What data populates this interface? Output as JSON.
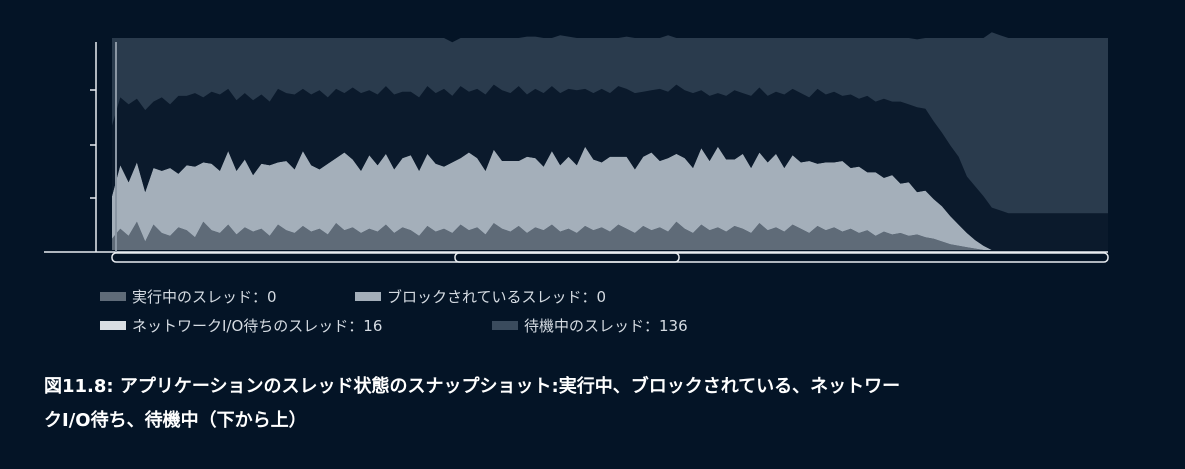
{
  "chart_data": {
    "type": "area",
    "stacking": "stacked",
    "series_order": "bottom-to-top",
    "x": [
      0,
      1,
      2,
      3,
      4,
      5,
      6,
      7,
      8,
      9,
      10,
      11,
      12,
      13,
      14,
      15,
      16,
      17,
      18,
      19,
      20,
      21,
      22,
      23,
      24,
      25,
      26,
      27,
      28,
      29,
      30,
      31,
      32,
      33,
      34,
      35,
      36,
      37,
      38,
      39,
      40,
      41,
      42,
      43,
      44,
      45,
      46,
      47,
      48,
      49,
      50,
      51,
      52,
      53,
      54,
      55,
      56,
      57,
      58,
      59,
      60,
      61,
      62,
      63,
      64,
      65,
      66,
      67,
      68,
      69,
      70,
      71,
      72,
      73,
      74,
      75,
      76,
      77,
      78,
      79,
      80,
      81,
      82,
      83,
      84,
      85,
      86,
      87,
      88,
      89,
      90,
      91,
      92,
      93,
      94,
      95,
      96,
      97,
      98,
      99,
      100,
      101,
      102,
      103,
      104,
      105,
      106,
      107,
      108,
      109,
      110,
      111,
      112,
      113,
      114,
      115,
      116,
      117,
      118,
      119,
      120
    ],
    "series": [
      {
        "name": "実行中のスレッド：0",
        "color": "#5f6b78",
        "values": [
          8,
          15,
          10,
          20,
          6,
          18,
          12,
          10,
          16,
          14,
          9,
          20,
          14,
          12,
          18,
          11,
          16,
          13,
          15,
          10,
          18,
          14,
          12,
          17,
          13,
          15,
          11,
          19,
          14,
          16,
          12,
          15,
          13,
          18,
          12,
          16,
          14,
          10,
          17,
          13,
          15,
          12,
          18,
          14,
          16,
          11,
          19,
          15,
          13,
          17,
          12,
          16,
          14,
          18,
          13,
          15,
          12,
          17,
          14,
          16,
          13,
          18,
          15,
          12,
          17,
          14,
          16,
          13,
          20,
          15,
          12,
          18,
          14,
          16,
          13,
          17,
          15,
          12,
          19,
          14,
          16,
          13,
          18,
          15,
          12,
          17,
          14,
          16,
          13,
          15,
          12,
          14,
          10,
          13,
          11,
          12,
          10,
          11,
          9,
          8,
          6,
          4,
          3,
          2,
          1,
          0,
          0,
          0,
          0,
          0,
          0,
          0,
          0,
          0,
          0,
          0,
          0,
          0,
          0,
          0,
          0
        ]
      },
      {
        "name": "ブロックされているスレッド：0",
        "color": "#a4afba",
        "values": [
          30,
          45,
          38,
          42,
          35,
          40,
          44,
          48,
          38,
          46,
          50,
          42,
          47,
          44,
          52,
          45,
          48,
          40,
          46,
          50,
          44,
          49,
          45,
          53,
          47,
          42,
          50,
          46,
          55,
          48,
          44,
          52,
          47,
          50,
          45,
          49,
          53,
          46,
          51,
          48,
          44,
          50,
          47,
          55,
          49,
          45,
          52,
          48,
          50,
          46,
          54,
          49,
          45,
          52,
          47,
          51,
          48,
          56,
          50,
          46,
          53,
          48,
          51,
          45,
          49,
          55,
          47,
          52,
          48,
          50,
          46,
          54,
          49,
          57,
          51,
          47,
          53,
          46,
          50,
          48,
          52,
          45,
          49,
          47,
          51,
          44,
          48,
          46,
          50,
          43,
          47,
          41,
          45,
          38,
          42,
          35,
          38,
          30,
          33,
          28,
          25,
          20,
          15,
          10,
          6,
          3,
          0,
          0,
          0,
          0,
          0,
          0,
          0,
          0,
          0,
          0,
          0,
          0,
          0,
          0,
          0
        ]
      },
      {
        "name": "ネットワークI/O待ちのスレッド：16",
        "color": "#0b1a2c",
        "values": [
          50,
          48,
          55,
          45,
          58,
          47,
          52,
          45,
          55,
          49,
          52,
          46,
          51,
          54,
          44,
          50,
          47,
          53,
          49,
          45,
          52,
          48,
          53,
          44,
          50,
          56,
          47,
          49,
          42,
          51,
          55,
          46,
          50,
          48,
          53,
          47,
          45,
          52,
          48,
          50,
          55,
          47,
          51,
          43,
          49,
          54,
          46,
          50,
          48,
          53,
          44,
          49,
          52,
          46,
          51,
          48,
          53,
          41,
          47,
          52,
          45,
          50,
          48,
          54,
          46,
          44,
          51,
          47,
          49,
          48,
          53,
          41,
          46,
          38,
          45,
          49,
          43,
          51,
          46,
          47,
          44,
          52,
          47,
          49,
          45,
          53,
          48,
          50,
          46,
          52,
          48,
          54,
          50,
          56,
          52,
          58,
          55,
          60,
          58,
          55,
          52,
          50,
          48,
          40,
          38,
          35,
          30,
          28,
          26,
          26,
          26,
          26,
          26,
          26,
          26,
          26,
          26,
          26,
          26,
          26,
          26
        ]
      },
      {
        "name": "待機中のスレッド：136",
        "color": "#2a3b4d",
        "values": [
          62,
          42,
          47,
          43,
          51,
          45,
          42,
          47,
          41,
          41,
          39,
          42,
          38,
          40,
          36,
          44,
          39,
          44,
          40,
          45,
          36,
          39,
          40,
          36,
          40,
          37,
          42,
          36,
          39,
          35,
          39,
          37,
          40,
          34,
          40,
          38,
          38,
          42,
          34,
          39,
          36,
          38,
          34,
          38,
          36,
          40,
          33,
          37,
          39,
          34,
          41,
          37,
          39,
          34,
          41,
          37,
          37,
          36,
          39,
          36,
          39,
          34,
          37,
          39,
          38,
          37,
          36,
          40,
          33,
          37,
          39,
          37,
          41,
          39,
          41,
          37,
          39,
          41,
          35,
          41,
          38,
          40,
          36,
          39,
          42,
          36,
          40,
          38,
          41,
          40,
          43,
          41,
          45,
          43,
          45,
          45,
          47,
          48,
          50,
          59,
          67,
          76,
          84,
          98,
          105,
          112,
          124,
          124,
          124,
          124,
          124,
          124,
          124,
          124,
          124,
          124,
          124,
          124,
          124,
          124,
          124
        ]
      }
    ],
    "ylim": [
      0,
      150
    ],
    "title": "",
    "xlabel": "",
    "ylabel": "",
    "legend_position": "bottom-left",
    "grid": false
  },
  "legend": [
    {
      "label": "実行中のスレッド：0",
      "color": "#5f6b78"
    },
    {
      "label": "ブロックされているスレッド：0",
      "color": "#a4afba"
    },
    {
      "label": "ネットワークI/O待ちのスレッド：16",
      "color": "#d9dee3"
    },
    {
      "label": "待機中のスレッド：136",
      "color": "#3a4b5d"
    }
  ],
  "caption": {
    "line1": "図11.8: アプリケーションのスレッド状態のスナップショット:実行中、ブロックされている、ネットワー",
    "line2": "クI/O待ち、待機中（下から上）"
  },
  "colors": {
    "background": "#041426",
    "axis": "#e8ecf0"
  }
}
